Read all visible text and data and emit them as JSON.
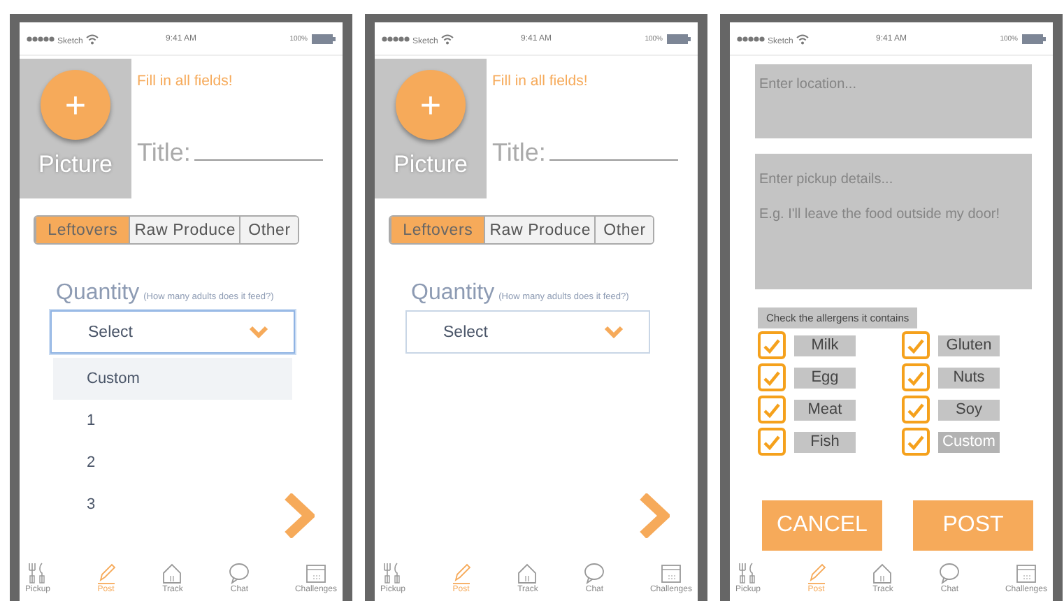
{
  "screens": [
    {
      "kind": "details",
      "status_bar": {
        "carrier": "Sketch",
        "time": "9:41 AM",
        "battery": "100%"
      },
      "picture": {
        "button": "+",
        "label": "Picture"
      },
      "warning": "Fill in all fields!",
      "title_label": "Title:",
      "categories": [
        {
          "label": "Leftovers",
          "selected": true
        },
        {
          "label": "Raw Produce",
          "selected": false
        },
        {
          "label": "Other",
          "selected": false
        }
      ],
      "quantity": {
        "label": "Quantity",
        "hint": "(How many adults does it feed?)",
        "value": "Select",
        "expanded": true,
        "options": [
          {
            "label": "Custom",
            "selected": true
          },
          {
            "label": "1",
            "selected": false
          },
          {
            "label": "2",
            "selected": false
          },
          {
            "label": "3",
            "selected": false
          }
        ]
      },
      "nav": [
        {
          "label": "Pickup",
          "selected": false
        },
        {
          "label": "Post",
          "selected": true
        },
        {
          "label": "Track",
          "selected": false
        },
        {
          "label": "Chat",
          "selected": false
        },
        {
          "label": "Challenges",
          "selected": false
        }
      ]
    },
    {
      "kind": "details",
      "status_bar": {
        "carrier": "Sketch",
        "time": "9:41 AM",
        "battery": "100%"
      },
      "picture": {
        "button": "+",
        "label": "Picture"
      },
      "warning": "Fill in all fields!",
      "title_label": "Title:",
      "categories": [
        {
          "label": "Leftovers",
          "selected": true
        },
        {
          "label": "Raw Produce",
          "selected": false
        },
        {
          "label": "Other",
          "selected": false
        }
      ],
      "quantity": {
        "label": "Quantity",
        "hint": "(How many adults does it feed?)",
        "value": "Select",
        "expanded": false
      },
      "nav": [
        {
          "label": "Pickup",
          "selected": false
        },
        {
          "label": "Post",
          "selected": true
        },
        {
          "label": "Track",
          "selected": false
        },
        {
          "label": "Chat",
          "selected": false
        },
        {
          "label": "Challenges",
          "selected": false
        }
      ]
    },
    {
      "kind": "extras",
      "status_bar": {
        "carrier": "Sketch",
        "time": "9:41 AM",
        "battery": "100%"
      },
      "location": {
        "placeholder": "Enter location..."
      },
      "pickup_details": {
        "placeholder": "Enter pickup details...\n\nE.g. I'll leave the food outside my door!"
      },
      "allergens": {
        "heading": "Check the allergens it contains",
        "items": [
          {
            "kind": "label",
            "label": "Milk",
            "checked": true
          },
          {
            "kind": "label",
            "label": "Gluten",
            "checked": true
          },
          {
            "kind": "label",
            "label": "Egg",
            "checked": true
          },
          {
            "kind": "label",
            "label": "Nuts",
            "checked": true
          },
          {
            "kind": "label",
            "label": "Meat",
            "checked": true
          },
          {
            "kind": "label",
            "label": "Soy",
            "checked": true
          },
          {
            "kind": "label",
            "label": "Fish",
            "checked": true
          },
          {
            "kind": "custom",
            "placeholder": "Custom",
            "checked": true
          }
        ]
      },
      "buttons": [
        "CANCEL",
        "POST"
      ],
      "nav": [
        {
          "label": "Pickup",
          "selected": false
        },
        {
          "label": "Post",
          "selected": true
        },
        {
          "label": "Track",
          "selected": false
        },
        {
          "label": "Chat",
          "selected": false
        },
        {
          "label": "Challenges",
          "selected": false
        }
      ]
    }
  ]
}
